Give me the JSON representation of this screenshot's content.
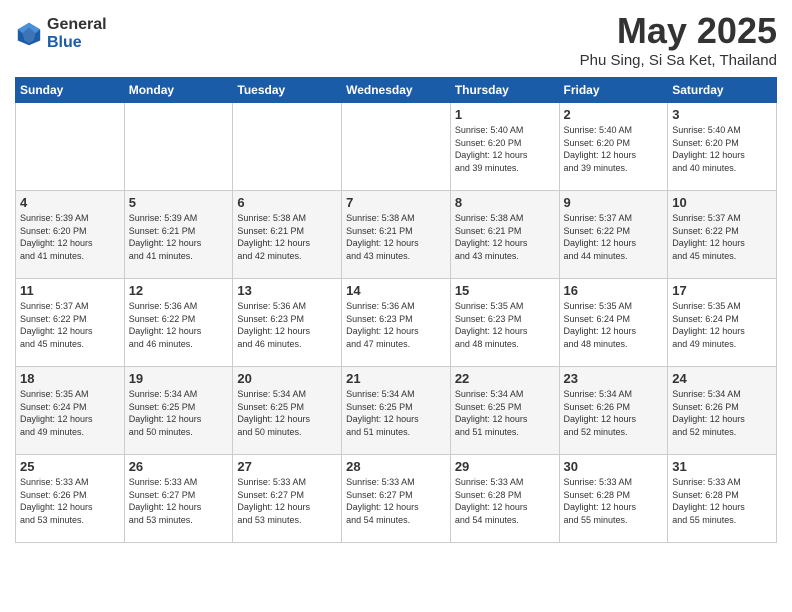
{
  "logo": {
    "general": "General",
    "blue": "Blue"
  },
  "title": "May 2025",
  "location": "Phu Sing, Si Sa Ket, Thailand",
  "days_of_week": [
    "Sunday",
    "Monday",
    "Tuesday",
    "Wednesday",
    "Thursday",
    "Friday",
    "Saturday"
  ],
  "weeks": [
    [
      {
        "day": "",
        "info": ""
      },
      {
        "day": "",
        "info": ""
      },
      {
        "day": "",
        "info": ""
      },
      {
        "day": "",
        "info": ""
      },
      {
        "day": "1",
        "info": "Sunrise: 5:40 AM\nSunset: 6:20 PM\nDaylight: 12 hours\nand 39 minutes."
      },
      {
        "day": "2",
        "info": "Sunrise: 5:40 AM\nSunset: 6:20 PM\nDaylight: 12 hours\nand 39 minutes."
      },
      {
        "day": "3",
        "info": "Sunrise: 5:40 AM\nSunset: 6:20 PM\nDaylight: 12 hours\nand 40 minutes."
      }
    ],
    [
      {
        "day": "4",
        "info": "Sunrise: 5:39 AM\nSunset: 6:20 PM\nDaylight: 12 hours\nand 41 minutes."
      },
      {
        "day": "5",
        "info": "Sunrise: 5:39 AM\nSunset: 6:21 PM\nDaylight: 12 hours\nand 41 minutes."
      },
      {
        "day": "6",
        "info": "Sunrise: 5:38 AM\nSunset: 6:21 PM\nDaylight: 12 hours\nand 42 minutes."
      },
      {
        "day": "7",
        "info": "Sunrise: 5:38 AM\nSunset: 6:21 PM\nDaylight: 12 hours\nand 43 minutes."
      },
      {
        "day": "8",
        "info": "Sunrise: 5:38 AM\nSunset: 6:21 PM\nDaylight: 12 hours\nand 43 minutes."
      },
      {
        "day": "9",
        "info": "Sunrise: 5:37 AM\nSunset: 6:22 PM\nDaylight: 12 hours\nand 44 minutes."
      },
      {
        "day": "10",
        "info": "Sunrise: 5:37 AM\nSunset: 6:22 PM\nDaylight: 12 hours\nand 45 minutes."
      }
    ],
    [
      {
        "day": "11",
        "info": "Sunrise: 5:37 AM\nSunset: 6:22 PM\nDaylight: 12 hours\nand 45 minutes."
      },
      {
        "day": "12",
        "info": "Sunrise: 5:36 AM\nSunset: 6:22 PM\nDaylight: 12 hours\nand 46 minutes."
      },
      {
        "day": "13",
        "info": "Sunrise: 5:36 AM\nSunset: 6:23 PM\nDaylight: 12 hours\nand 46 minutes."
      },
      {
        "day": "14",
        "info": "Sunrise: 5:36 AM\nSunset: 6:23 PM\nDaylight: 12 hours\nand 47 minutes."
      },
      {
        "day": "15",
        "info": "Sunrise: 5:35 AM\nSunset: 6:23 PM\nDaylight: 12 hours\nand 48 minutes."
      },
      {
        "day": "16",
        "info": "Sunrise: 5:35 AM\nSunset: 6:24 PM\nDaylight: 12 hours\nand 48 minutes."
      },
      {
        "day": "17",
        "info": "Sunrise: 5:35 AM\nSunset: 6:24 PM\nDaylight: 12 hours\nand 49 minutes."
      }
    ],
    [
      {
        "day": "18",
        "info": "Sunrise: 5:35 AM\nSunset: 6:24 PM\nDaylight: 12 hours\nand 49 minutes."
      },
      {
        "day": "19",
        "info": "Sunrise: 5:34 AM\nSunset: 6:25 PM\nDaylight: 12 hours\nand 50 minutes."
      },
      {
        "day": "20",
        "info": "Sunrise: 5:34 AM\nSunset: 6:25 PM\nDaylight: 12 hours\nand 50 minutes."
      },
      {
        "day": "21",
        "info": "Sunrise: 5:34 AM\nSunset: 6:25 PM\nDaylight: 12 hours\nand 51 minutes."
      },
      {
        "day": "22",
        "info": "Sunrise: 5:34 AM\nSunset: 6:25 PM\nDaylight: 12 hours\nand 51 minutes."
      },
      {
        "day": "23",
        "info": "Sunrise: 5:34 AM\nSunset: 6:26 PM\nDaylight: 12 hours\nand 52 minutes."
      },
      {
        "day": "24",
        "info": "Sunrise: 5:34 AM\nSunset: 6:26 PM\nDaylight: 12 hours\nand 52 minutes."
      }
    ],
    [
      {
        "day": "25",
        "info": "Sunrise: 5:33 AM\nSunset: 6:26 PM\nDaylight: 12 hours\nand 53 minutes."
      },
      {
        "day": "26",
        "info": "Sunrise: 5:33 AM\nSunset: 6:27 PM\nDaylight: 12 hours\nand 53 minutes."
      },
      {
        "day": "27",
        "info": "Sunrise: 5:33 AM\nSunset: 6:27 PM\nDaylight: 12 hours\nand 53 minutes."
      },
      {
        "day": "28",
        "info": "Sunrise: 5:33 AM\nSunset: 6:27 PM\nDaylight: 12 hours\nand 54 minutes."
      },
      {
        "day": "29",
        "info": "Sunrise: 5:33 AM\nSunset: 6:28 PM\nDaylight: 12 hours\nand 54 minutes."
      },
      {
        "day": "30",
        "info": "Sunrise: 5:33 AM\nSunset: 6:28 PM\nDaylight: 12 hours\nand 55 minutes."
      },
      {
        "day": "31",
        "info": "Sunrise: 5:33 AM\nSunset: 6:28 PM\nDaylight: 12 hours\nand 55 minutes."
      }
    ]
  ]
}
